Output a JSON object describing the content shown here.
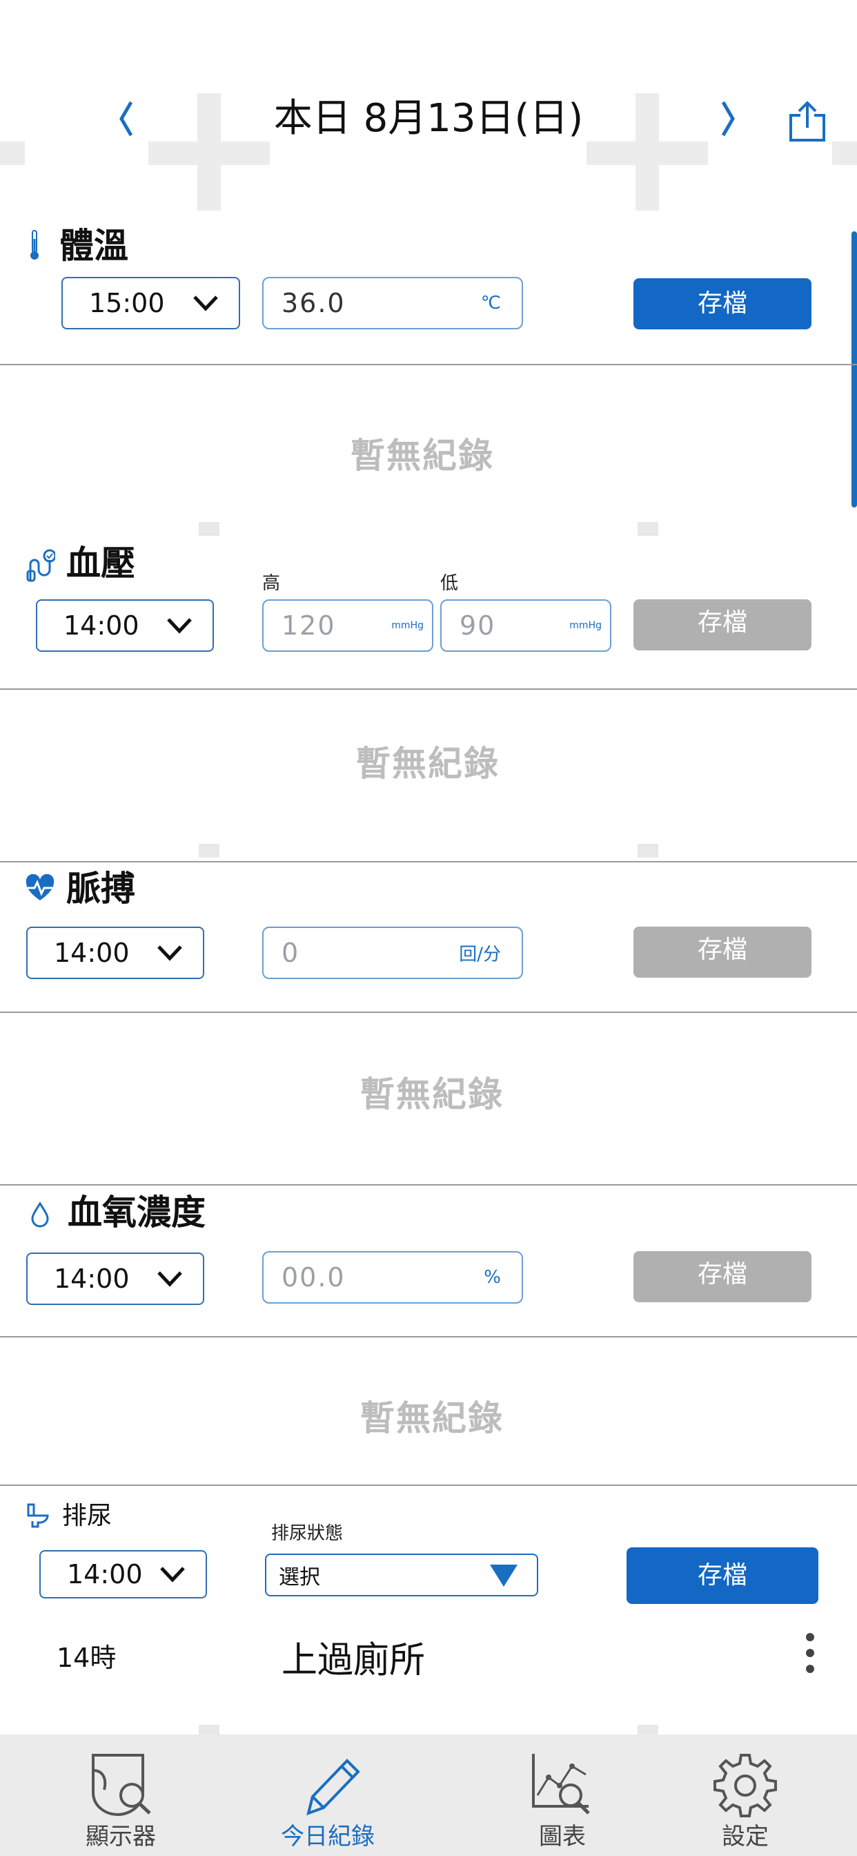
{
  "header": {
    "title": "本日 8月13日(日)",
    "prev_icon": "chevron-left-icon",
    "next_icon": "chevron-right-icon",
    "share_icon": "share-icon"
  },
  "temperature": {
    "title": "體溫",
    "icon": "thermometer-icon",
    "time": "15:00",
    "value": "36.0",
    "unit": "℃",
    "save": "存檔",
    "empty": "暫無紀錄"
  },
  "blood_pressure": {
    "title": "血壓",
    "icon": "blood-pressure-icon",
    "time": "14:00",
    "high_label": "高",
    "low_label": "低",
    "high_placeholder": "120",
    "low_placeholder": "90",
    "unit": "mmHg",
    "save": "存檔",
    "empty": "暫無紀錄"
  },
  "pulse": {
    "title": "脈搏",
    "icon": "heart-pulse-icon",
    "time": "14:00",
    "placeholder": "0",
    "unit": "回/分",
    "save": "存檔",
    "empty": "暫無紀錄"
  },
  "oxygen": {
    "title": "血氧濃度",
    "icon": "drop-icon",
    "time": "14:00",
    "placeholder": "00.0",
    "unit": "%",
    "save": "存檔",
    "empty": "暫無紀錄"
  },
  "urination": {
    "title": "排尿",
    "icon": "toilet-icon",
    "time": "14:00",
    "status_label": "排尿狀態",
    "status_value": "選択",
    "save": "存檔",
    "record_time": "14時",
    "record_text": "上過廁所"
  },
  "tabs": [
    {
      "label": "顯示器",
      "icon": "diaper-search-icon",
      "active": false
    },
    {
      "label": "今日紀錄",
      "icon": "pencil-icon",
      "active": true
    },
    {
      "label": "圖表",
      "icon": "chart-search-icon",
      "active": false
    },
    {
      "label": "設定",
      "icon": "gear-icon",
      "active": false
    }
  ],
  "colors": {
    "accent": "#1268c4",
    "disabled": "#b0b0b0",
    "tab_bar": "#ebebeb"
  }
}
